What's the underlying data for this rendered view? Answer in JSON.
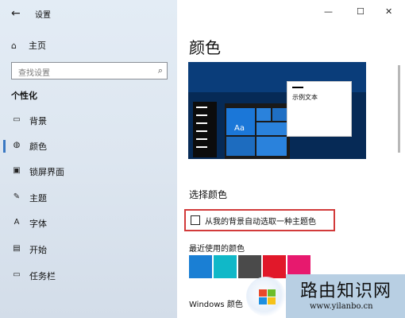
{
  "window": {
    "app_title": "设置"
  },
  "sidebar": {
    "home_label": "主页",
    "search_placeholder": "查找设置",
    "section_label": "个性化",
    "items": [
      {
        "label": "背景"
      },
      {
        "label": "颜色"
      },
      {
        "label": "锁屏界面"
      },
      {
        "label": "主题"
      },
      {
        "label": "字体"
      },
      {
        "label": "开始"
      },
      {
        "label": "任务栏"
      }
    ]
  },
  "main": {
    "page_title": "颜色",
    "preview_sample_text": "示例文本",
    "preview_tile_text": "Aa",
    "choose_color_title": "选择颜色",
    "auto_pick_label": "从我的背景自动选取一种主题色",
    "auto_pick_checked": false,
    "recent_colors_title": "最近使用的颜色",
    "recent_colors": [
      "#1a7fd4",
      "#10b8c8",
      "#4a4a4a",
      "#e1182a",
      "#e7196e"
    ],
    "windows_colors_title": "Windows 颜色"
  },
  "window_controls": {
    "minimize": "—",
    "maximize": "☐",
    "close": "✕"
  },
  "watermark": {
    "title": "路由知识网",
    "url": "www.yilanbo.cn"
  }
}
